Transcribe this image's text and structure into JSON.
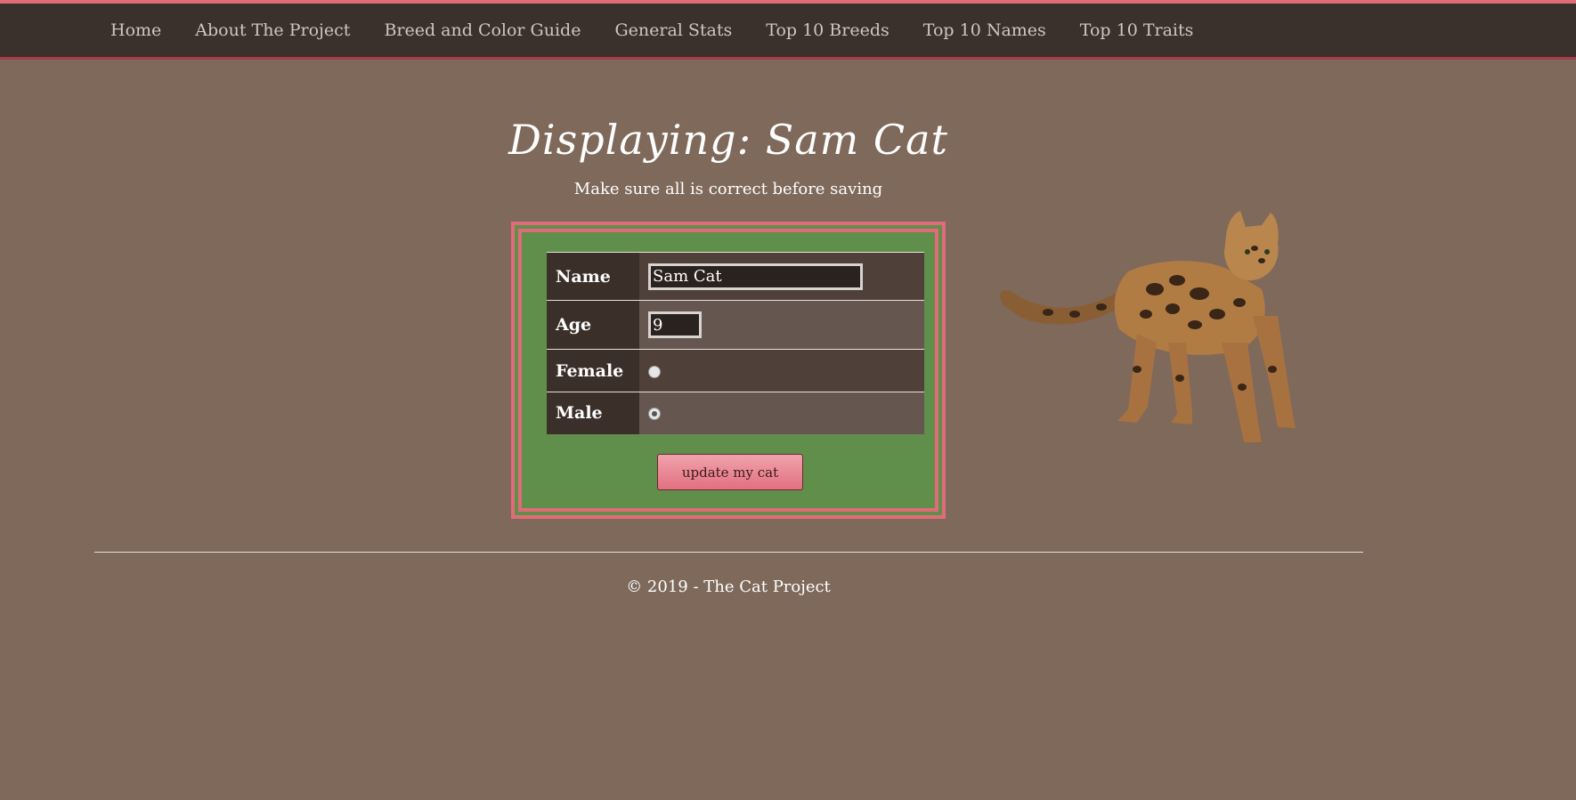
{
  "nav": {
    "items": [
      {
        "label": "Home"
      },
      {
        "label": "About The Project"
      },
      {
        "label": "Breed and Color Guide"
      },
      {
        "label": "General Stats"
      },
      {
        "label": "Top 10 Breeds"
      },
      {
        "label": "Top 10 Names"
      },
      {
        "label": "Top 10 Traits"
      }
    ]
  },
  "header": {
    "title": "Displaying: Sam Cat",
    "subtitle": "Make sure all is correct before saving"
  },
  "form": {
    "name_label": "Name",
    "name_value": "Sam Cat",
    "age_label": "Age",
    "age_value": "9",
    "female_label": "Female",
    "female_checked": false,
    "male_label": "Male",
    "male_checked": true,
    "submit_label": "update my cat"
  },
  "footer": {
    "text": "© 2019 - The Cat Project"
  },
  "colors": {
    "background": "#7e695b",
    "navbar": "#3b312c",
    "accent_pink": "#e26b79",
    "form_green": "#5f8f4a"
  }
}
